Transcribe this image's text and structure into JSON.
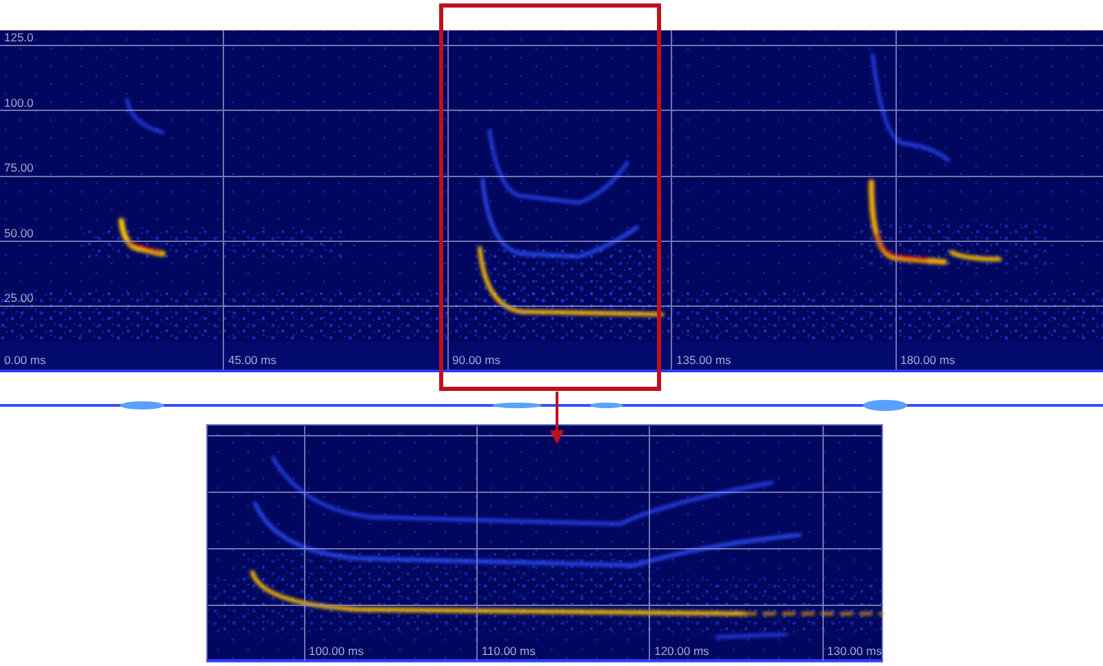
{
  "overview": {
    "y_labels": [
      "125.0",
      "100.0",
      "75.00",
      "50.00",
      "25.00"
    ],
    "x_labels": [
      "0.00 ms",
      "45.00 ms",
      "90.00 ms",
      "135.00 ms",
      "180.00 ms"
    ]
  },
  "zoom_view": {
    "x_labels": [
      "100.00 ms",
      "110.00 ms",
      "120.00 ms",
      "130.00 ms"
    ]
  }
}
